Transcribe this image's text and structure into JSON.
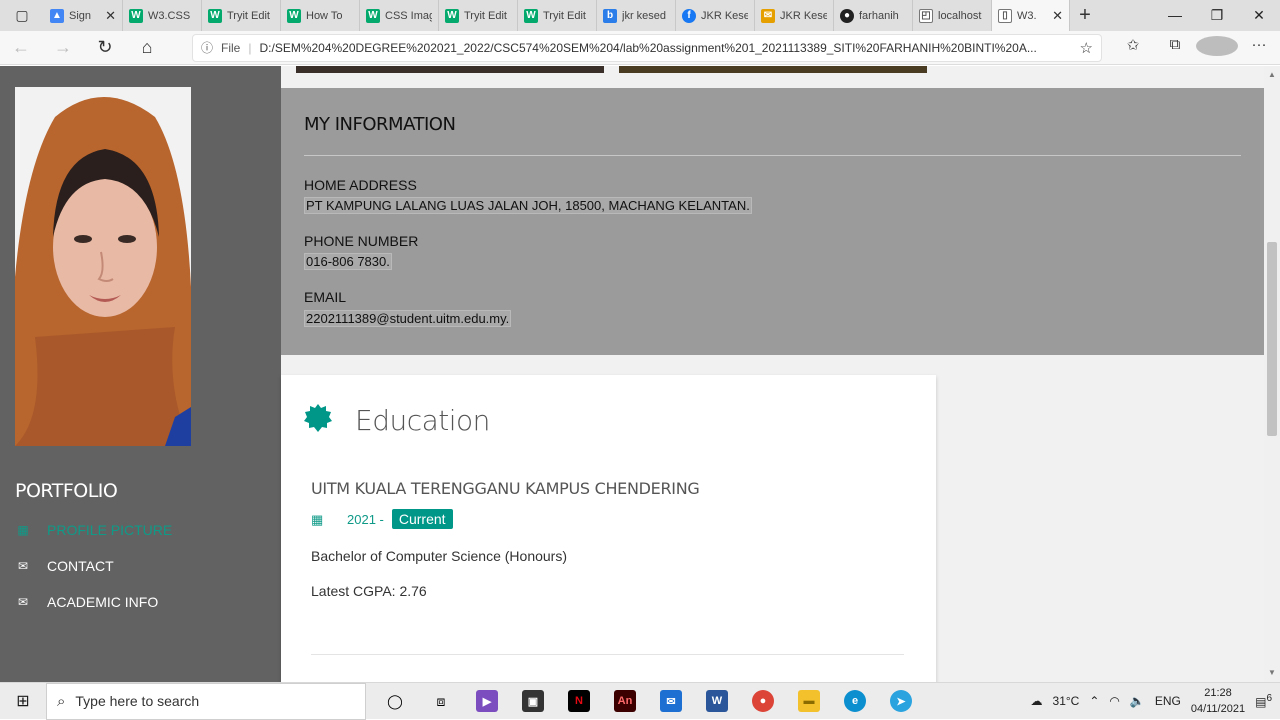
{
  "browser": {
    "tabs": [
      {
        "title": "Sign",
        "icon": "google-drive-icon",
        "color": "#4285f4"
      },
      {
        "title": "W3.CSS",
        "icon": "w3schools-icon",
        "color": "#04aa6d"
      },
      {
        "title": "Tryit Edit",
        "icon": "w3schools-icon",
        "color": "#04aa6d"
      },
      {
        "title": "How To",
        "icon": "w3schools-icon",
        "color": "#04aa6d"
      },
      {
        "title": "CSS Imag",
        "icon": "w3schools-icon",
        "color": "#04aa6d"
      },
      {
        "title": "Tryit Edit",
        "icon": "w3schools-icon",
        "color": "#04aa6d"
      },
      {
        "title": "Tryit Edit",
        "icon": "w3schools-icon",
        "color": "#04aa6d"
      },
      {
        "title": "jkr kesed",
        "icon": "bing-icon",
        "color": "#2b7de9"
      },
      {
        "title": "JKR Kese",
        "icon": "facebook-icon",
        "color": "#1877f2"
      },
      {
        "title": "JKR Kese",
        "icon": "mail-icon",
        "color": "#e5a000"
      },
      {
        "title": "farhanih",
        "icon": "github-icon",
        "color": "#222222"
      },
      {
        "title": "localhost",
        "icon": "page-icon",
        "color": "#555555"
      },
      {
        "title": "W3.",
        "icon": "page-icon",
        "color": "#555555",
        "active": true
      }
    ],
    "url_prefix": "File",
    "url": "D:/SEM%204%20DEGREE%202021_2022/CSC574%20SEM%204/lab%20assignment%201_2021113389_SITI%20FARHANIH%20BINTI%20A..."
  },
  "sidebar": {
    "title": "PORTFOLIO",
    "items": [
      {
        "label": "PROFILE PICTURE",
        "icon": "image-icon",
        "active": true
      },
      {
        "label": "CONTACT",
        "icon": "envelope-icon"
      },
      {
        "label": "ACADEMIC INFO",
        "icon": "envelope-icon"
      }
    ]
  },
  "info": {
    "title": "MY INFORMATION",
    "address_label": "HOME ADDRESS",
    "address_value": "PT KAMPUNG LALANG LUAS JALAN JOH, 18500, MACHANG KELANTAN.",
    "phone_label": "PHONE NUMBER",
    "phone_value": "016-806 7830.",
    "email_label": "EMAIL",
    "email_value": "2202111389@student.uitm.edu.my."
  },
  "education": {
    "heading": "Education",
    "school": "UITM KUALA TERENGGANU KAMPUS CHENDERING",
    "year": "2021 -",
    "badge": "Current",
    "degree": "Bachelor of Computer Science (Honours)",
    "cgpa": "Latest CGPA: 2.76"
  },
  "taskbar": {
    "search_placeholder": "Type here to search",
    "temperature": "31°C",
    "language": "ENG",
    "time": "21:28",
    "date": "04/11/2021",
    "notification_count": "6"
  },
  "colors": {
    "accent": "#009688",
    "panel": "#9b9b9b",
    "sidebar": "#626262"
  }
}
